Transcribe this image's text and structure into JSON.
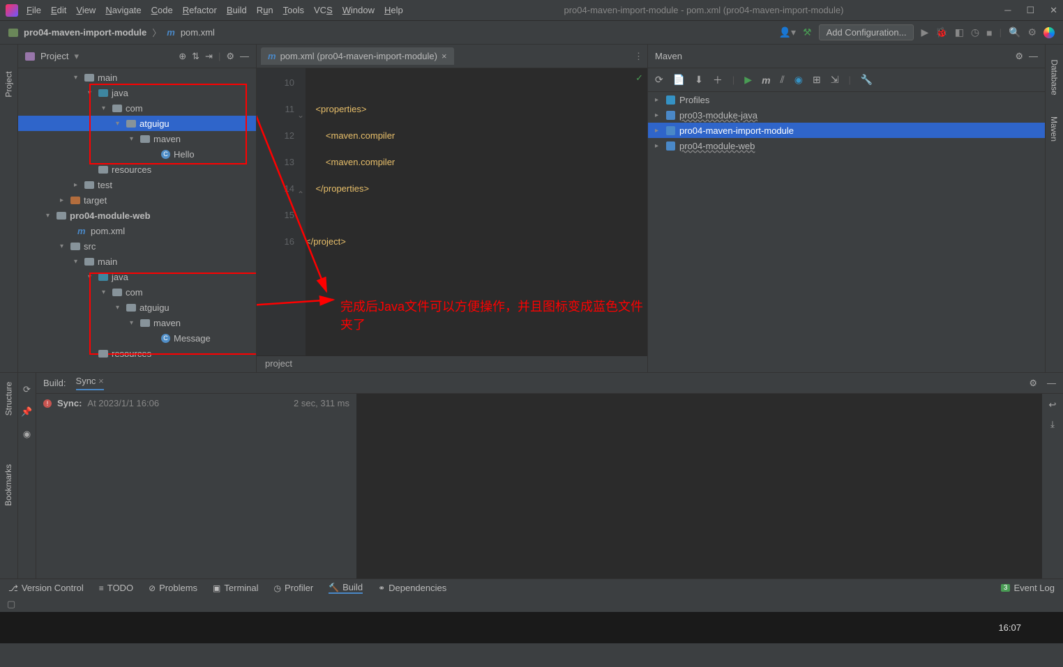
{
  "window": {
    "title": "pro04-maven-import-module - pom.xml (pro04-maven-import-module)"
  },
  "menu": [
    "File",
    "Edit",
    "View",
    "Navigate",
    "Code",
    "Refactor",
    "Build",
    "Run",
    "Tools",
    "VCS",
    "Window",
    "Help"
  ],
  "breadcrumb": {
    "project": "pro04-maven-import-module",
    "file": "pom.xml"
  },
  "toolbar": {
    "addConfig": "Add Configuration..."
  },
  "projectPanel": {
    "title": "Project",
    "tree": [
      {
        "indent": 80,
        "arrow": "▾",
        "icon": "fld-gray",
        "label": "main"
      },
      {
        "indent": 100,
        "arrow": "▾",
        "icon": "fld-blue",
        "label": "java"
      },
      {
        "indent": 120,
        "arrow": "▾",
        "icon": "fld-gray",
        "label": "com"
      },
      {
        "indent": 140,
        "arrow": "▾",
        "icon": "fld-gray",
        "label": "atguigu",
        "sel": true
      },
      {
        "indent": 160,
        "arrow": "▾",
        "icon": "fld-gray",
        "label": "maven"
      },
      {
        "indent": 190,
        "arrow": "",
        "icon": "cls",
        "label": "Hello"
      },
      {
        "indent": 100,
        "arrow": "",
        "icon": "fld-res",
        "label": "resources"
      },
      {
        "indent": 80,
        "arrow": "▸",
        "icon": "fld-gray",
        "label": "test"
      },
      {
        "indent": 60,
        "arrow": "▸",
        "icon": "fld-orange",
        "label": "target"
      },
      {
        "indent": 40,
        "arrow": "▾",
        "icon": "fld-gray",
        "label": "pro04-module-web",
        "bold": true
      },
      {
        "indent": 70,
        "arrow": "",
        "icon": "m-ico",
        "label": "pom.xml"
      },
      {
        "indent": 60,
        "arrow": "▾",
        "icon": "fld-gray",
        "label": "src"
      },
      {
        "indent": 80,
        "arrow": "▾",
        "icon": "fld-gray",
        "label": "main"
      },
      {
        "indent": 100,
        "arrow": "▾",
        "icon": "fld-blue",
        "label": "java"
      },
      {
        "indent": 120,
        "arrow": "▾",
        "icon": "fld-gray",
        "label": "com"
      },
      {
        "indent": 140,
        "arrow": "▾",
        "icon": "fld-gray",
        "label": "atguigu"
      },
      {
        "indent": 160,
        "arrow": "▾",
        "icon": "fld-gray",
        "label": "maven"
      },
      {
        "indent": 190,
        "arrow": "",
        "icon": "cls",
        "label": "Message"
      },
      {
        "indent": 100,
        "arrow": "",
        "icon": "fld-res",
        "label": "resources"
      }
    ]
  },
  "editor": {
    "tabLabel": "pom.xml (pro04-maven-import-module)",
    "gutter": [
      "10",
      "11",
      "12",
      "13",
      "14",
      "15",
      "16"
    ],
    "lines": [
      "",
      "    <properties>",
      "        <maven.compiler",
      "        <maven.compiler",
      "    </properties>",
      "",
      "</project>"
    ],
    "breadcrumb": "project"
  },
  "annotation": "完成后Java文件可以方便操作，并且图标变成蓝色文件夹了",
  "maven": {
    "title": "Maven",
    "items": [
      {
        "label": "Profiles",
        "icon": "prof"
      },
      {
        "label": "pro03-moduke-java",
        "icon": "mvn",
        "wavy": true
      },
      {
        "label": "pro04-maven-import-module",
        "icon": "mvn",
        "sel": true
      },
      {
        "label": "pro04-module-web",
        "icon": "mvn",
        "wavy": true
      }
    ]
  },
  "build": {
    "label": "Build:",
    "syncTab": "Sync",
    "syncTitle": "Sync:",
    "syncTime": "At 2023/1/1 16:06",
    "duration": "2 sec, 311 ms"
  },
  "bottomTabs": [
    "Version Control",
    "TODO",
    "Problems",
    "Terminal",
    "Profiler",
    "Build",
    "Dependencies"
  ],
  "eventLog": {
    "count": "3",
    "label": "Event Log"
  },
  "leftTabs": [
    "Project"
  ],
  "leftTabs2": [
    "Structure",
    "Bookmarks"
  ],
  "rightTabs": [
    "Database",
    "Maven"
  ],
  "taskbar": {
    "time": "16:07"
  }
}
